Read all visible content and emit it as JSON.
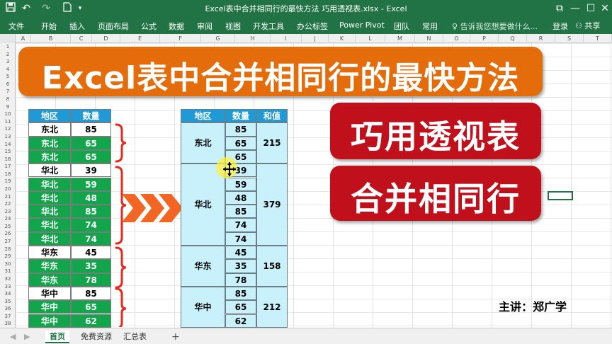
{
  "window": {
    "title": "Excel表中合并相同行的最快方法 巧用透视表.xlsx - Excel",
    "quick_access": {
      "save": "save-icon",
      "undo": "undo-icon",
      "redo": "redo-icon",
      "new": "new-file-icon"
    },
    "controls": {
      "restore": "⧉",
      "minimize": "—",
      "maximize": "☐",
      "close": "✕"
    }
  },
  "ribbon": {
    "tabs": [
      "文件",
      "开始",
      "插入",
      "页面布局",
      "公式",
      "数据",
      "审阅",
      "视图",
      "开发工具",
      "办公标签",
      "Power Pivot",
      "团队",
      "常用"
    ],
    "tell_me": "告诉我您想要做什么...",
    "sign_in": "登录",
    "share": "共享"
  },
  "columns": [
    "A",
    "B",
    "C",
    "D",
    "E",
    "F",
    "G",
    "H",
    "I",
    "J",
    "K",
    "L",
    "M",
    "N",
    "O",
    "P",
    "Q",
    "R",
    "S",
    "T",
    "U",
    "V",
    "W"
  ],
  "rows": [
    "1",
    "2",
    "3",
    "4",
    "5",
    "6",
    "7",
    "8",
    "9",
    "10",
    "11",
    "12",
    "13",
    "14",
    "15",
    "16",
    "17",
    "18",
    "19",
    "20",
    "21",
    "22",
    "23",
    "24",
    "25",
    "26",
    "27",
    "28",
    "29",
    "30",
    "31",
    "32",
    "33",
    "34",
    "35",
    "36",
    "37",
    "38"
  ],
  "banner": {
    "text": "Excel表中合并相同行的最快方法"
  },
  "left_table": {
    "headers": [
      "地区",
      "数量"
    ],
    "rows": [
      {
        "region": "东北",
        "qty": "85",
        "style": "white"
      },
      {
        "region": "东北",
        "qty": "65",
        "style": "green"
      },
      {
        "region": "东北",
        "qty": "65",
        "style": "green"
      },
      {
        "region": "华北",
        "qty": "39",
        "style": "white"
      },
      {
        "region": "华北",
        "qty": "59",
        "style": "green"
      },
      {
        "region": "华北",
        "qty": "48",
        "style": "green"
      },
      {
        "region": "华北",
        "qty": "85",
        "style": "green"
      },
      {
        "region": "华北",
        "qty": "74",
        "style": "green"
      },
      {
        "region": "华北",
        "qty": "74",
        "style": "green"
      },
      {
        "region": "华东",
        "qty": "45",
        "style": "white"
      },
      {
        "region": "华东",
        "qty": "35",
        "style": "green"
      },
      {
        "region": "华东",
        "qty": "78",
        "style": "green"
      },
      {
        "region": "华中",
        "qty": "85",
        "style": "white"
      },
      {
        "region": "华中",
        "qty": "65",
        "style": "green"
      },
      {
        "region": "华中",
        "qty": "62",
        "style": "green"
      }
    ]
  },
  "pivot_table": {
    "headers": [
      "地区",
      "数量",
      "和值"
    ],
    "groups": [
      {
        "region": "东北",
        "values": [
          "85",
          "65",
          "65"
        ],
        "sum": "215"
      },
      {
        "region": "华北",
        "values": [
          "39",
          "59",
          "48",
          "85",
          "74",
          "74"
        ],
        "sum": "379"
      },
      {
        "region": "华东",
        "values": [
          "45",
          "35",
          "78"
        ],
        "sum": "158"
      },
      {
        "region": "华中",
        "values": [
          "85",
          "65",
          "62"
        ],
        "sum": "212"
      }
    ]
  },
  "buttons": {
    "pivot": "巧用透视表",
    "merge": "合并相同行"
  },
  "author": "主讲：郑广学",
  "sheets": {
    "tabs": [
      "首页",
      "免费资源",
      "汇总表"
    ],
    "active": "首页",
    "add": "+"
  },
  "colors": {
    "excel_green": "#217346",
    "banner_orange": "#e46c0a",
    "header_blue": "#1f9ad6",
    "row_green": "#12a54b",
    "pivot_cyan": "#c9f1fb",
    "button_red": "#c0101c",
    "bracket_red": "#e8281c"
  }
}
